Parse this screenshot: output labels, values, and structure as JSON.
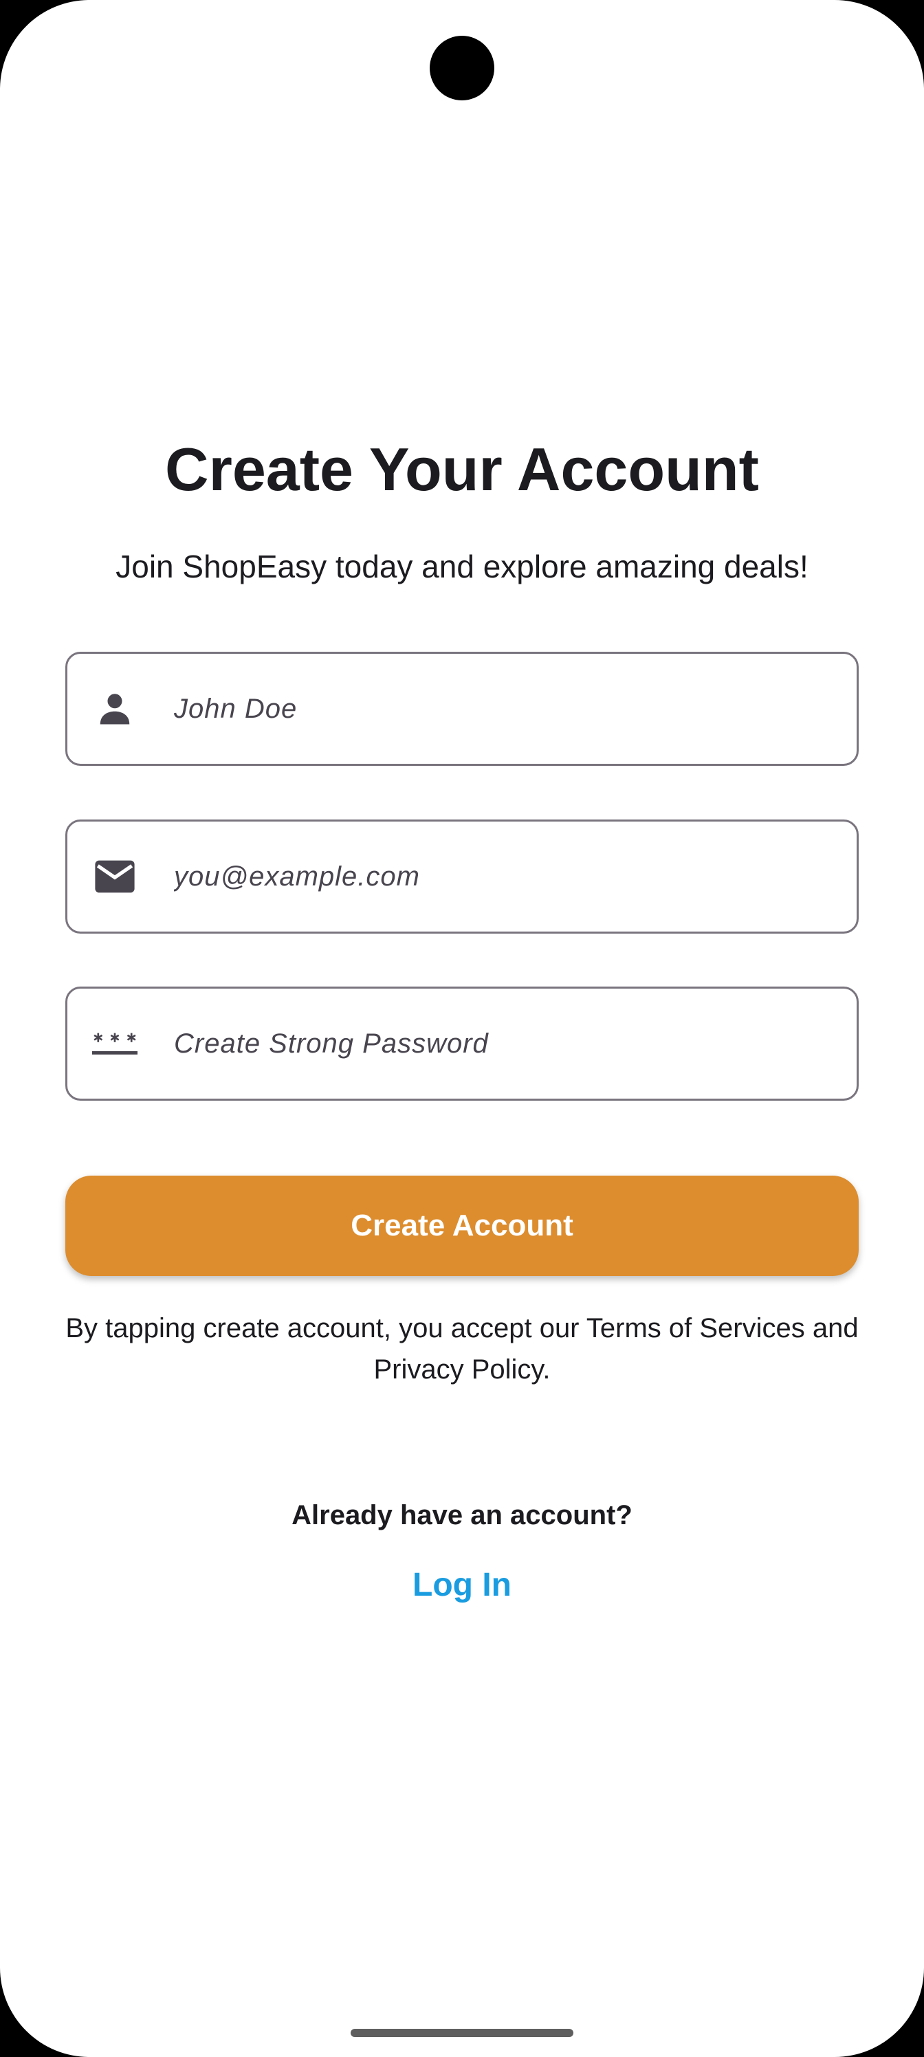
{
  "page": {
    "title": "Create Your Account",
    "subtitle": "Join ShopEasy today and explore amazing deals!"
  },
  "form": {
    "name_field": {
      "placeholder": "John Doe",
      "icon": "person-icon"
    },
    "email_field": {
      "placeholder": "you@example.com",
      "icon": "email-icon"
    },
    "password_field": {
      "placeholder": "Create Strong Password",
      "icon": "password-icon"
    },
    "submit_label": "Create Account"
  },
  "terms_text": "By tapping create account, you accept our Terms of Services and Privacy Policy.",
  "footer": {
    "prompt": "Already have an account?",
    "login_label": "Log In"
  },
  "colors": {
    "accent": "#dd8d2e",
    "link": "#1a9ce0",
    "text": "#1c1b1f",
    "field_border": "#79747e",
    "icon": "#49454f"
  }
}
